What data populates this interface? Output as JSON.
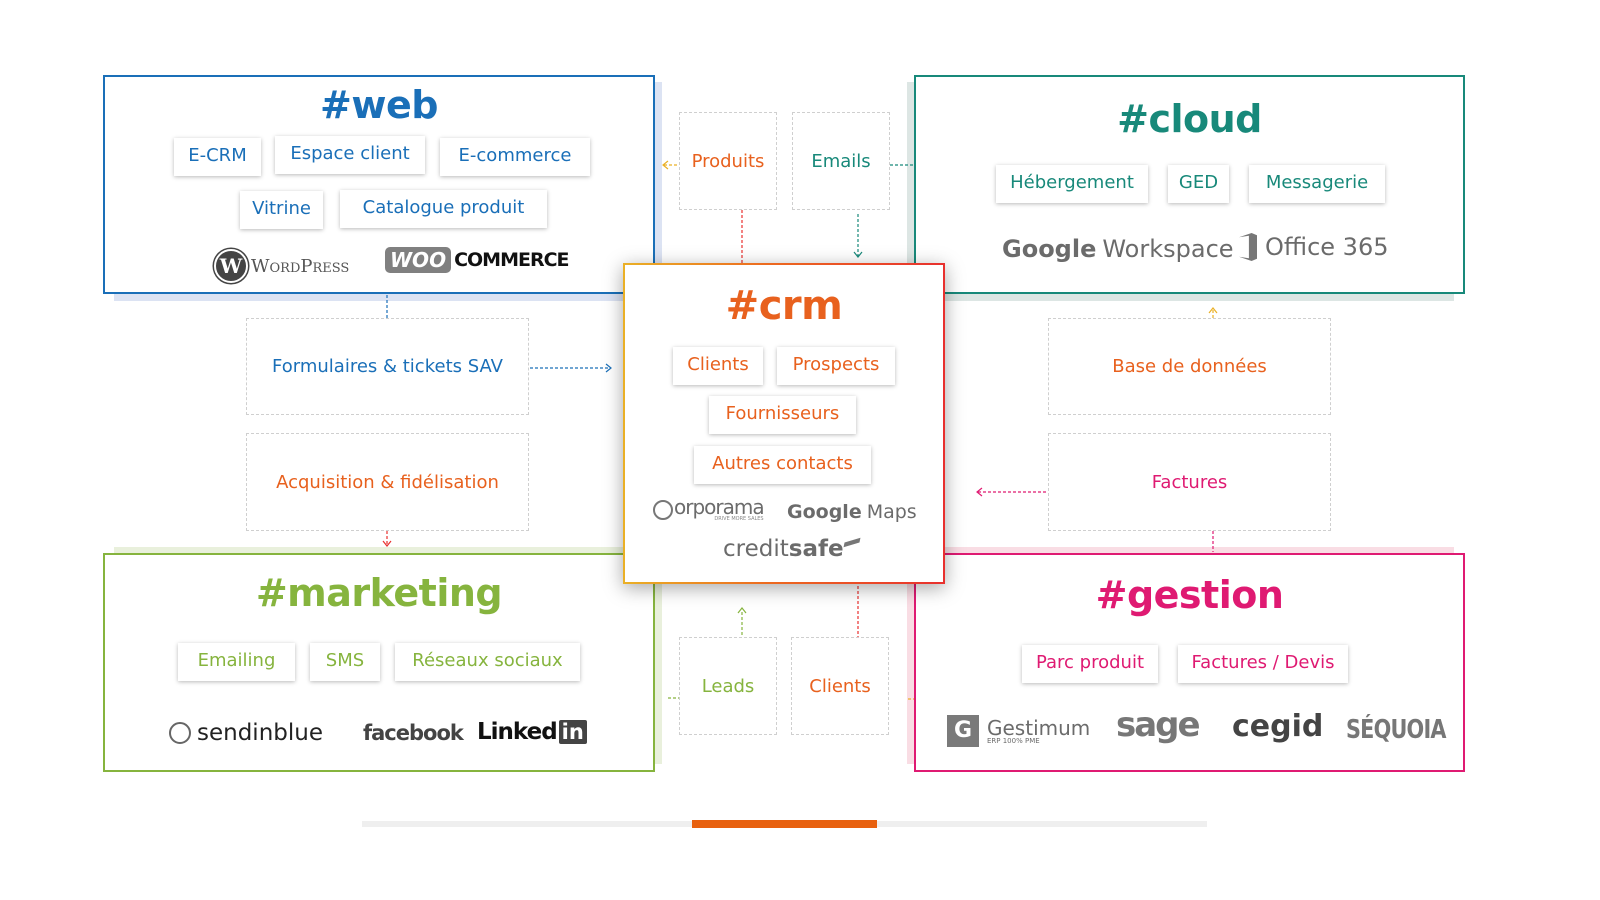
{
  "colors": {
    "web": "#1a6fb8",
    "cloud": "#18897a",
    "marketing": "#86b43e",
    "gestion": "#df1a72",
    "crm": "#e8611e",
    "crm_border_start": "#eab026",
    "crm_border_end": "#e8302e",
    "logo_gray": "#6b6b6b",
    "slider_track": "#efefef",
    "slider_thumb": "#e8610f"
  },
  "web": {
    "title": "#web",
    "tags": [
      "E-CRM",
      "Espace client",
      "E-commerce",
      "Vitrine",
      "Catalogue produit"
    ],
    "logos": {
      "wordpress": "WordPress",
      "woo_badge": "WOO",
      "woo_text": "COMMERCE"
    }
  },
  "cloud": {
    "title": "#cloud",
    "tags": [
      "Hébergement",
      "GED",
      "Messagerie"
    ],
    "logos": {
      "google_workspace_g": "Google",
      "google_workspace_w": "Workspace",
      "office365": "Office 365"
    }
  },
  "crm": {
    "title": "#crm",
    "tags": [
      "Clients",
      "Prospects",
      "Fournisseurs",
      "Autres contacts"
    ],
    "logos": {
      "corporama": "orporama",
      "corporama_sub": "DRIVE MORE SALES",
      "google_maps_g": "Google",
      "google_maps_m": "Maps",
      "creditsafe_a": "credit",
      "creditsafe_b": "safe"
    }
  },
  "marketing": {
    "title": "#marketing",
    "tags": [
      "Emailing",
      "SMS",
      "Réseaux sociaux"
    ],
    "logos": {
      "sendinblue": "sendinblue",
      "facebook": "facebook",
      "linkedin": "Linked",
      "linkedin_badge": "in"
    }
  },
  "gestion": {
    "title": "#gestion",
    "tags": [
      "Parc produit",
      "Factures / Devis"
    ],
    "logos": {
      "gestimum": "Gestimum",
      "gestimum_sub": "ERP 100% PME",
      "gestimum_badge": "G",
      "sage": "sage",
      "cegid": "cegid",
      "sequoia": "SÉQUOIA"
    }
  },
  "flows": {
    "produits": "Produits",
    "emails": "Emails",
    "formulaires": "Formulaires & tickets SAV",
    "acquisition": "Acquisition & fidélisation",
    "base_donnees": "Base de données",
    "factures": "Factures",
    "leads": "Leads",
    "clients": "Clients"
  },
  "slider": {
    "position_fraction": 0.5
  }
}
